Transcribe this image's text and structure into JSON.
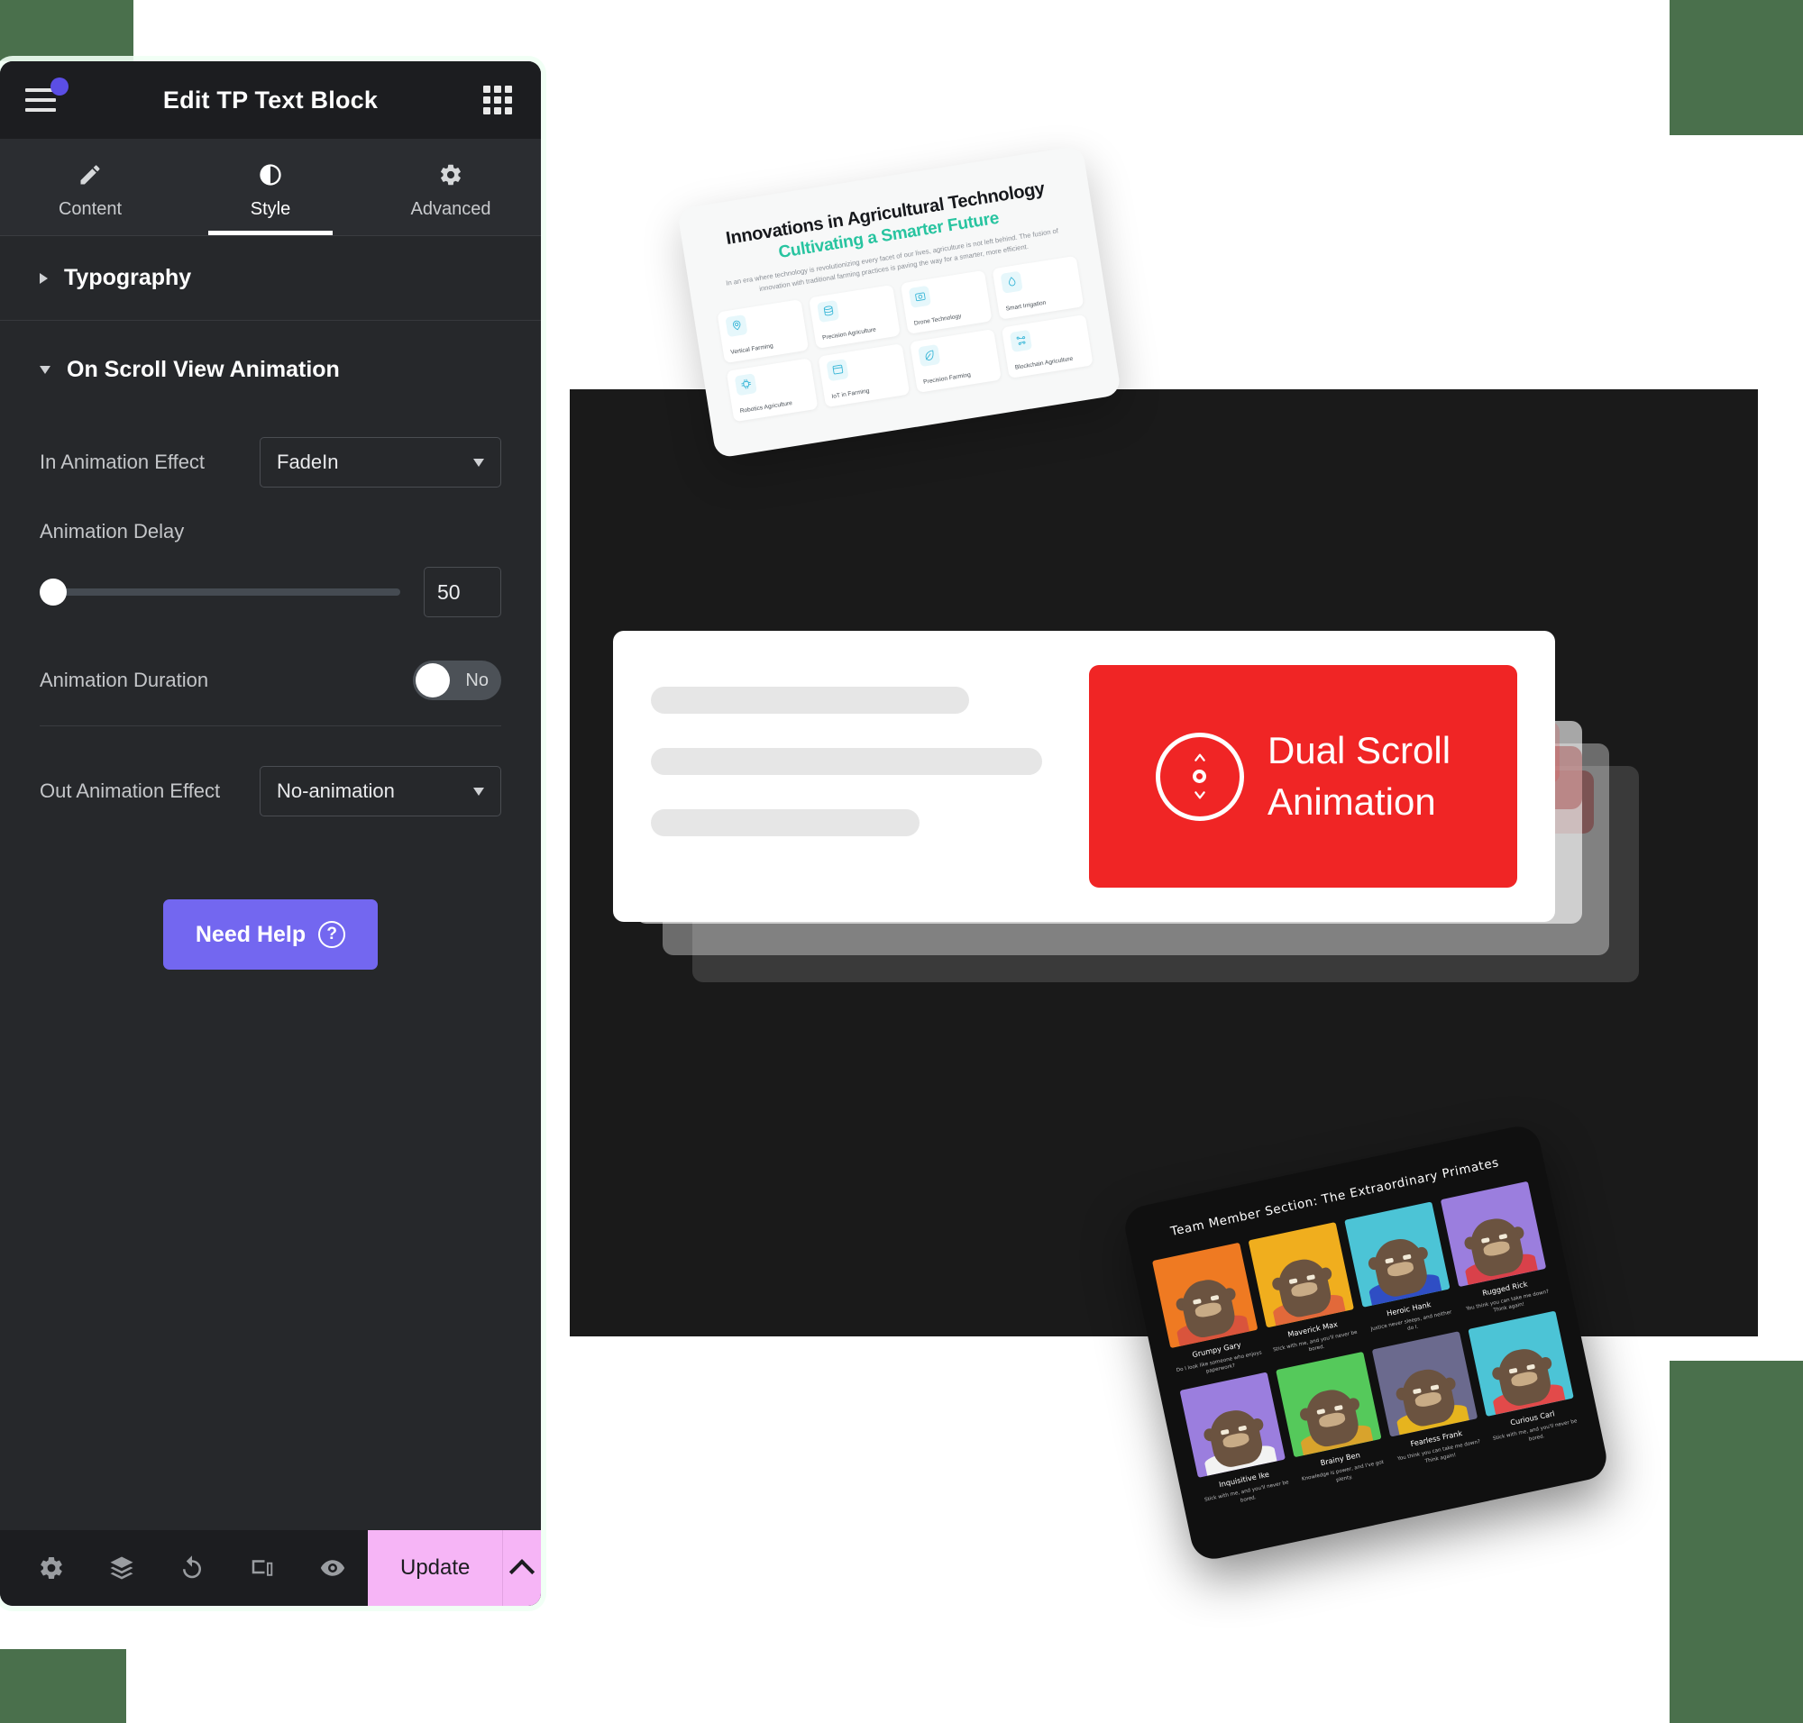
{
  "theme": {
    "accent_green": "#4a704c",
    "panel_bg": "#26282b",
    "panel_header_bg": "#1c1d20",
    "canvas_bg": "#1a1a1a",
    "help_button": "#7367f0",
    "update_button": "#f6b5f6",
    "dual_scroll_red": "#f02525",
    "agri_accent": "#28c4a0"
  },
  "editor": {
    "header": {
      "title": "Edit TP Text Block",
      "menu_icon": "hamburger-icon",
      "apps_icon": "grid-apps-icon",
      "notification_badge": true
    },
    "tabs": [
      {
        "label": "Content",
        "icon": "pencil-icon",
        "active": false
      },
      {
        "label": "Style",
        "icon": "contrast-half-circle-icon",
        "active": true
      },
      {
        "label": "Advanced",
        "icon": "gear-icon",
        "active": false
      }
    ],
    "sections": [
      {
        "title": "Typography",
        "expanded": false
      },
      {
        "title": "On Scroll View Animation",
        "expanded": true
      }
    ],
    "controls": {
      "in_animation_effect": {
        "label": "In Animation Effect",
        "value": "FadeIn"
      },
      "animation_delay": {
        "label": "Animation Delay",
        "value": "50",
        "slider_percent": 0
      },
      "animation_duration": {
        "label": "Animation Duration",
        "toggle_value": "No",
        "toggle_on": false
      },
      "out_animation_effect": {
        "label": "Out Animation Effect",
        "value": "No-animation"
      }
    },
    "help_button": {
      "label": "Need Help",
      "icon": "question-circle-icon",
      "glyph": "?"
    },
    "footer": {
      "icons": [
        "gear-icon",
        "layers-icon",
        "history-revert-icon",
        "responsive-devices-icon",
        "eye-preview-icon"
      ],
      "update_label": "Update",
      "caret_icon": "chevron-up-icon"
    }
  },
  "agriculture_card": {
    "title": "Innovations in Agricultural Technology",
    "subtitle": "Cultivating a Smarter Future",
    "description": "In an era where technology is revolutionizing every facet of our lives, agriculture is not left behind. The fusion of innovation with traditional farming practices is paving the way for a smarter, more efficient.",
    "features": [
      {
        "label": "Vertical Farming",
        "icon": "location-pin-icon"
      },
      {
        "label": "Precision Agriculture",
        "icon": "database-icon"
      },
      {
        "label": "Drone Technology",
        "icon": "camera-icon"
      },
      {
        "label": "Smart Irrigation",
        "icon": "water-drop-icon"
      },
      {
        "label": "Robotics Agriculture",
        "icon": "chip-icon"
      },
      {
        "label": "IoT in Farming",
        "icon": "browser-window-icon"
      },
      {
        "label": "Precision Farming",
        "icon": "leaf-icon"
      },
      {
        "label": "Blockchain Agriculture",
        "icon": "scatter-nodes-icon"
      }
    ]
  },
  "dual_scroll_card": {
    "badge_line_1": "Dual Scroll",
    "badge_line_2": "Animation",
    "badge_icon": "dual-scroll-arrows-icon",
    "skeleton_bars": 3
  },
  "team_tablet": {
    "title": "Team Member Section: The Extraordinary Primates",
    "members": [
      {
        "name": "Grumpy Gary",
        "quote": "Do I look like someone who enjoys paperwork?",
        "bg": "#ef7a22",
        "outfit": "#d9543c"
      },
      {
        "name": "Maverick Max",
        "quote": "Stick with me, and you'll never be bored.",
        "bg": "#f0ae1e",
        "outfit": "#e2693a"
      },
      {
        "name": "Heroic Hank",
        "quote": "Justice never sleeps, and neither do I.",
        "bg": "#4cc4d6",
        "outfit": "#2f4ec4"
      },
      {
        "name": "Rugged Rick",
        "quote": "You think you can take me down? Think again!",
        "bg": "#9b7ede",
        "outfit": "#d9414a"
      },
      {
        "name": "Inquisitive Ike",
        "quote": "Stick with me, and you'll never be bored.",
        "bg": "#9b7ede",
        "outfit": "#f2f2f2"
      },
      {
        "name": "Brainy Ben",
        "quote": "Knowledge is power, and I've got plenty.",
        "bg": "#55c95b",
        "outfit": "#d8a32c"
      },
      {
        "name": "Fearless Frank",
        "quote": "You think you can take me down? Think again!",
        "bg": "#6b6a8e",
        "outfit": "#e6b41e"
      },
      {
        "name": "Curious Carl",
        "quote": "Stick with me, and you'll never be bored.",
        "bg": "#4cc4d6",
        "outfit": "#e24a4a"
      }
    ]
  }
}
